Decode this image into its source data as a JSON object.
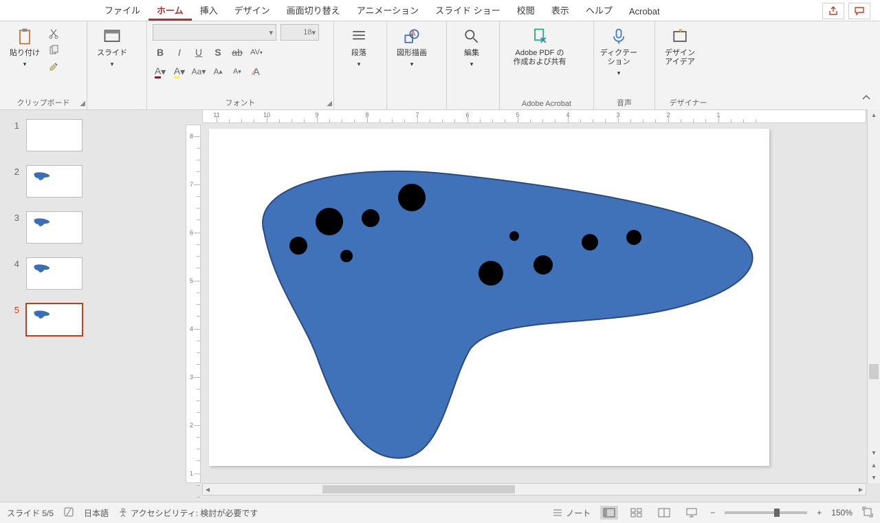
{
  "tabs": {
    "file": "ファイル",
    "home": "ホーム",
    "insert": "挿入",
    "design": "デザイン",
    "transitions": "画面切り替え",
    "animations": "アニメーション",
    "slideshow": "スライド ショー",
    "review": "校閲",
    "view": "表示",
    "help": "ヘルプ",
    "acrobat": "Acrobat"
  },
  "ribbon": {
    "clipboard": {
      "paste": "貼り付け",
      "label": "クリップボード"
    },
    "slides": {
      "btn": "スライド"
    },
    "font": {
      "size": "18",
      "label": "フォント"
    },
    "paragraph": {
      "btn": "段落"
    },
    "drawing": {
      "btn": "図形描画"
    },
    "editing": {
      "btn": "編集"
    },
    "acrobat": {
      "btn": "Adobe PDF の\n作成および共有",
      "label": "Adobe Acrobat"
    },
    "voice": {
      "btn": "ディクテー\nション",
      "label": "音声"
    },
    "designer": {
      "btn": "デザイン\nアイデア",
      "label": "デザイナー"
    }
  },
  "thumbs": {
    "1": "1",
    "2": "2",
    "3": "3",
    "4": "4",
    "5": "5"
  },
  "ruler_h": [
    "11",
    "10",
    "9",
    "8",
    "7",
    "6",
    "5",
    "4",
    "3",
    "2",
    "1"
  ],
  "ruler_v": [
    "8",
    "7",
    "6",
    "5",
    "4",
    "3",
    "2",
    "1"
  ],
  "status": {
    "slide": "スライド 5/5",
    "lang": "日本語",
    "a11y": "アクセシビリティ: 検討が必要です",
    "notes": "ノート",
    "zoom": "150%",
    "minus": "−",
    "plus": "+"
  },
  "colors": {
    "accent": "#a4373a",
    "shape": "#3a6fb7"
  }
}
